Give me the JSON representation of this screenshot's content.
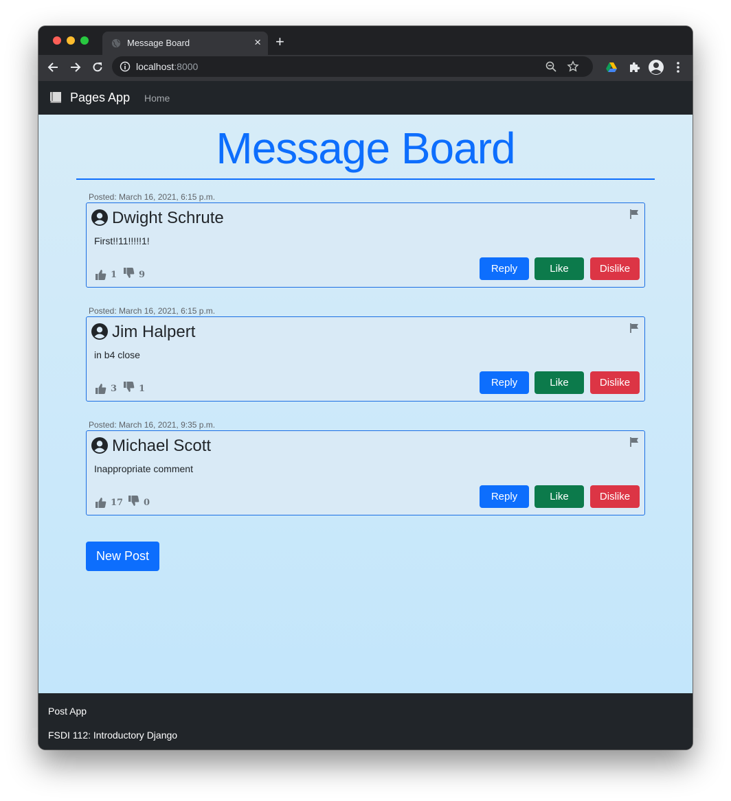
{
  "browser": {
    "tab_title": "Message Board",
    "tab_close": "×",
    "new_tab": "+",
    "url_host": "localhost",
    "url_port": ":8000"
  },
  "navbar": {
    "brand": "Pages App",
    "home": "Home"
  },
  "page": {
    "title": "Message Board"
  },
  "posts": [
    {
      "posted": "Posted: March 16, 2021, 6:15 p.m.",
      "author": "Dwight Schrute",
      "message": "First!!11!!!!!1!",
      "likes": "1",
      "dislikes": "9",
      "reply_label": "Reply",
      "like_label": "Like",
      "dislike_label": "Dislike"
    },
    {
      "posted": "Posted: March 16, 2021, 6:15 p.m.",
      "author": "Jim Halpert",
      "message": "in b4 close",
      "likes": "3",
      "dislikes": "1",
      "reply_label": "Reply",
      "like_label": "Like",
      "dislike_label": "Dislike"
    },
    {
      "posted": "Posted: March 16, 2021, 9:35 p.m.",
      "author": "Michael Scott",
      "message": "Inappropriate comment",
      "likes": "17",
      "dislikes": "0",
      "reply_label": "Reply",
      "like_label": "Like",
      "dislike_label": "Dislike"
    }
  ],
  "new_post_label": "New Post",
  "footer": {
    "line1": "Post App",
    "line2": "FSDI 112: Introductory Django"
  },
  "colors": {
    "primary": "#0d6efd",
    "success": "#0c7a4b",
    "danger": "#dc3545",
    "navbar": "#212529"
  }
}
